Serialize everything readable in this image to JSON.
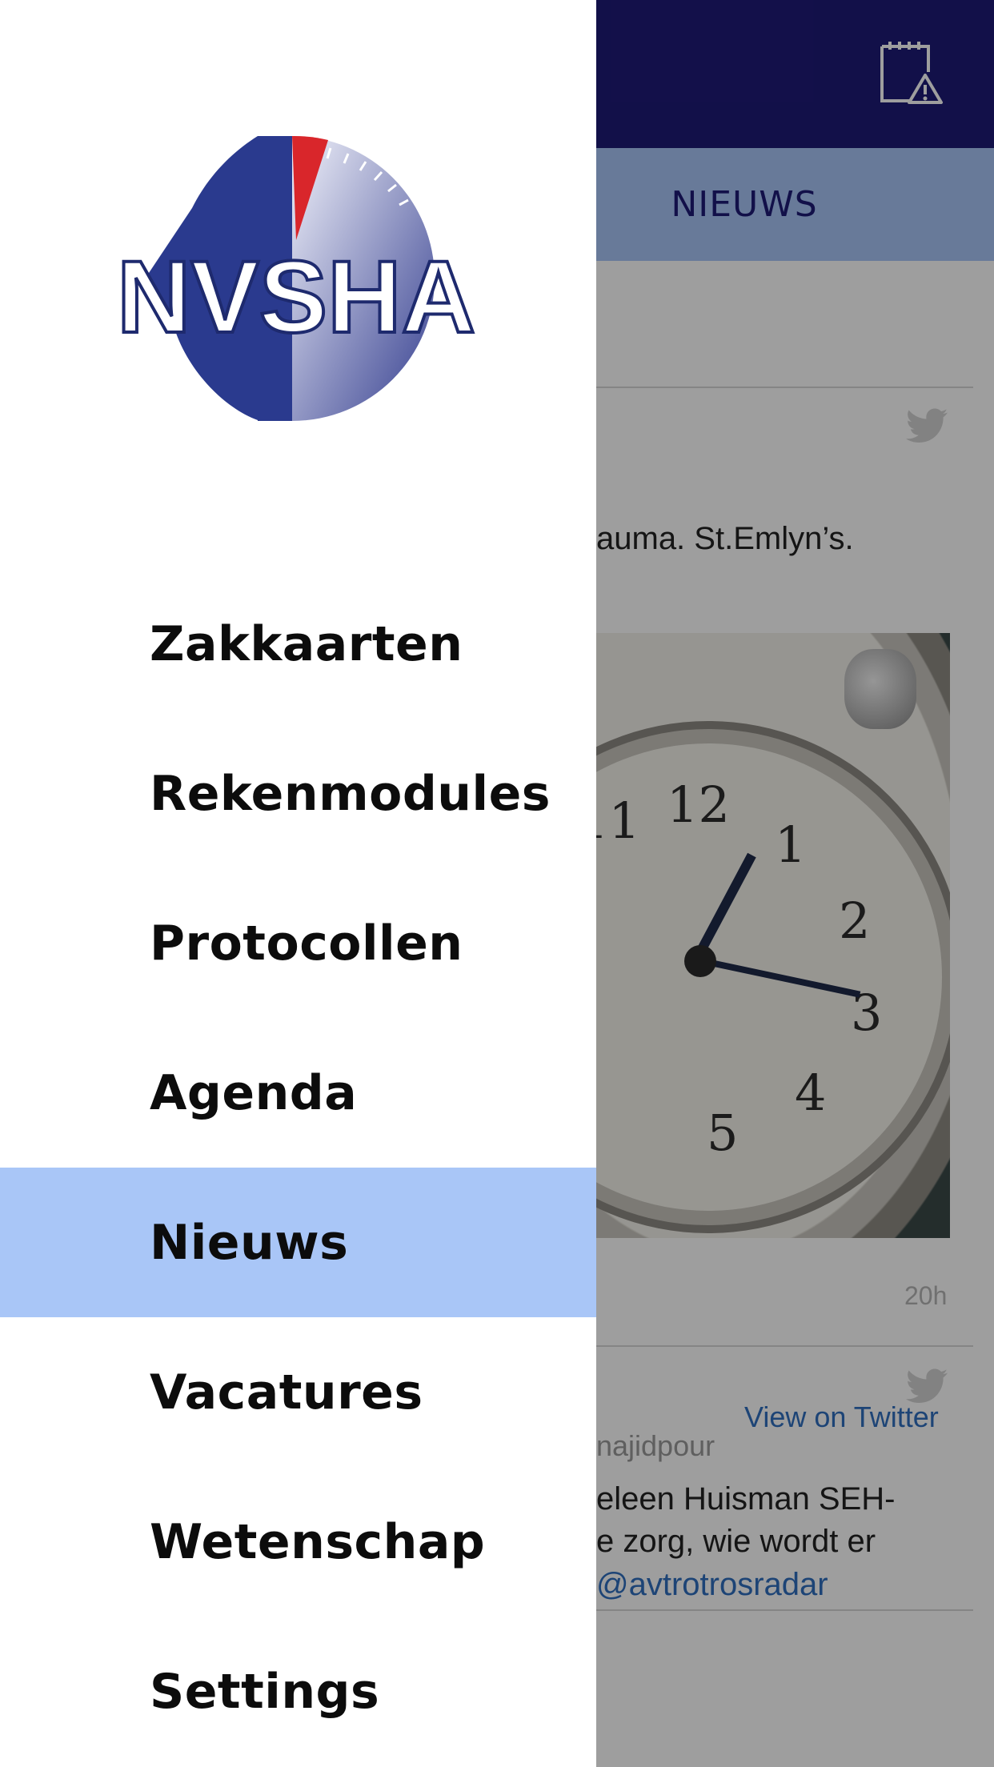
{
  "app": {
    "tab_label": "NIEUWS",
    "report_icon": "report-alert-icon"
  },
  "feed": {
    "tweet1": {
      "text_fragment": "auma. St.Emlyn’s.",
      "time": "20h",
      "icon": "twitter-bird-icon"
    },
    "tweet2": {
      "handle_fragment": "najidpour",
      "line1": "eleen Huisman SEH-",
      "line2": "e zorg, wie wordt er",
      "mention": "@avtrotrosradar",
      "icon": "twitter-bird-icon"
    },
    "view_on_twitter": "View on Twitter"
  },
  "drawer": {
    "logo_text": "NVSHA",
    "items": [
      {
        "label": "Zakkaarten",
        "active": false
      },
      {
        "label": "Rekenmodules",
        "active": false
      },
      {
        "label": "Protocollen",
        "active": false
      },
      {
        "label": "Agenda",
        "active": false
      },
      {
        "label": "Nieuws",
        "active": true
      },
      {
        "label": "Vacatures",
        "active": false
      },
      {
        "label": "Wetenschap",
        "active": false
      },
      {
        "label": "Settings",
        "active": false
      }
    ]
  },
  "colors": {
    "topbar": "#1e1a77",
    "tabbar": "#a9c6f7",
    "active_item": "#a9c6f7",
    "link": "#2f6fbf"
  }
}
